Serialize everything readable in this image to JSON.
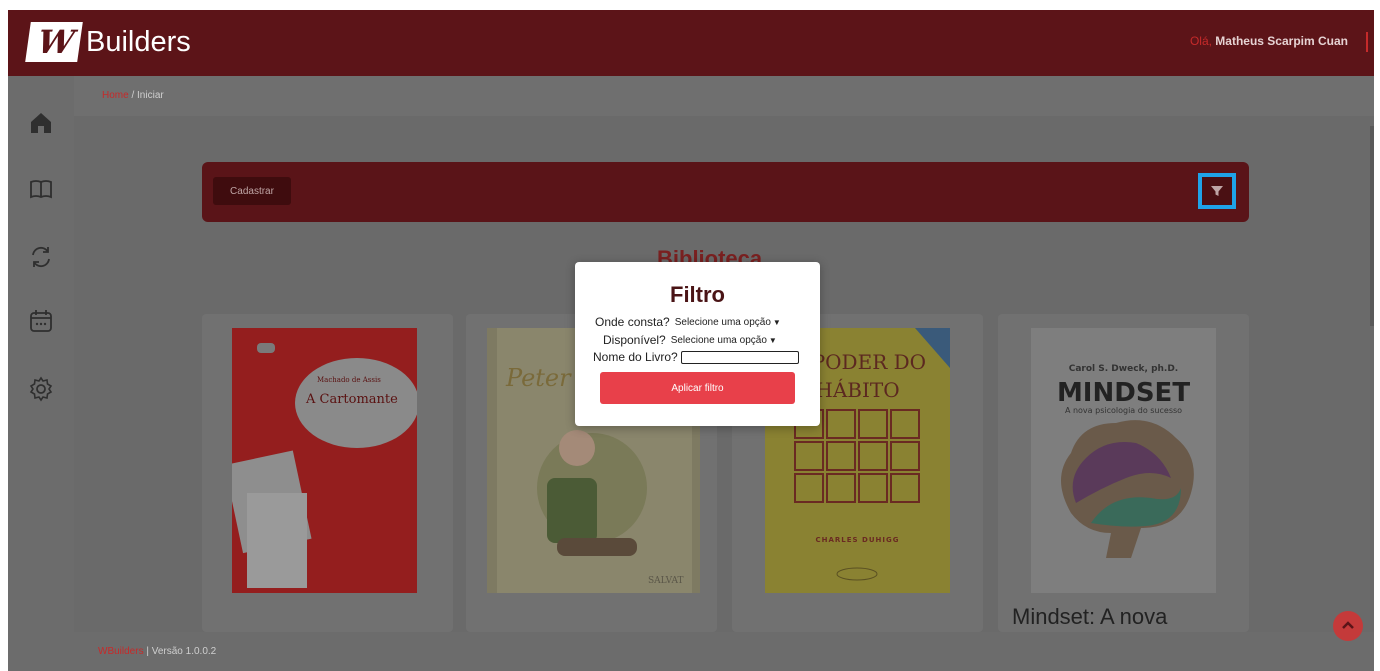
{
  "header": {
    "logo_mark": "W",
    "brand": "Builders",
    "greeting_prefix": "Olá,",
    "user_name": "Matheus Scarpim Cuan"
  },
  "sidebar": {
    "items": [
      {
        "icon": "home-icon"
      },
      {
        "icon": "book-icon"
      },
      {
        "icon": "refresh-icon"
      },
      {
        "icon": "calendar-icon"
      },
      {
        "icon": "gear-icon"
      }
    ]
  },
  "breadcrumb": {
    "home": "Home",
    "separator": " / ",
    "current": "Iniciar"
  },
  "toolbar": {
    "cadastrar_label": "Cadastrar"
  },
  "main": {
    "title": "Biblioteca"
  },
  "books": [
    {
      "cover_title": "A Cartomante",
      "cover_author": "Machado de Assis",
      "cover_color": "#a01f1f"
    },
    {
      "cover_title": "Peter Pan",
      "cover_publisher": "SALVAT",
      "cover_color": "#d9d4a6"
    },
    {
      "cover_title": "O PODER DO HÁBITO",
      "cover_author": "CHARLES DUHIGG",
      "cover_color": "#d7c63a"
    },
    {
      "cover_title": "MINDSET",
      "cover_subtitle": "A nova psicologia do sucesso",
      "cover_author": "Carol S. Dweck, ph.D.",
      "card_title": "Mindset: A nova",
      "cover_color": "#e8e8e8"
    }
  ],
  "footer": {
    "brand": "WBuilders",
    "version": " | Versão 1.0.0.2"
  },
  "filter_modal": {
    "title": "Filtro",
    "onde_label": "Onde consta?",
    "onde_value": "Selecione uma opção",
    "disponivel_label": "Disponível?",
    "disponivel_value": "Selecione uma opção",
    "nome_label": "Nome do Livro?",
    "nome_value": "",
    "apply_label": "Aplicar filtro"
  },
  "colors": {
    "primary": "#5c1418",
    "accent": "#c62a2a",
    "apply": "#e8404a",
    "highlight": "#1fa3e8"
  }
}
